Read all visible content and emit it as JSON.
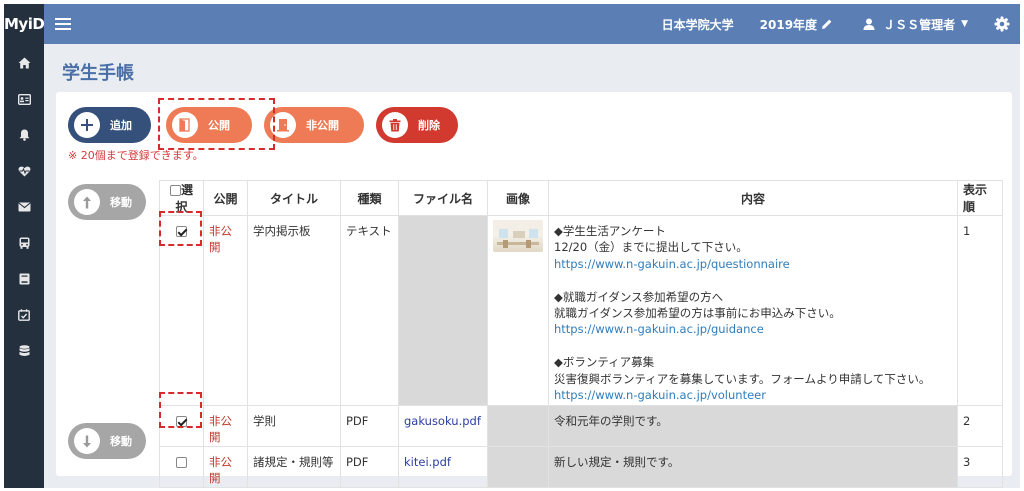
{
  "app": {
    "brand": "MyiD"
  },
  "header": {
    "university": "日本学院大学",
    "year": "2019年度",
    "user": "ＪＳＳ管理者"
  },
  "sidebar": {
    "icons": [
      "home-icon",
      "id-card-icon",
      "bell-icon",
      "heartbeat-icon",
      "envelope-icon",
      "bus-icon",
      "book-icon",
      "calendar-check-icon",
      "database-icon"
    ]
  },
  "page": {
    "title": "学生手帳"
  },
  "toolbar": {
    "add": "追加",
    "publish": "公開",
    "unpublish": "非公開",
    "delete": "削除",
    "note": "※ 20個まで登録できます。"
  },
  "move": {
    "up": "移動",
    "down": "移動"
  },
  "table": {
    "headers": {
      "select": "選択",
      "public": "公開",
      "title": "タイトル",
      "kind": "種類",
      "file": "ファイル名",
      "image": "画像",
      "content": "内容",
      "order": "表示順"
    },
    "rows": [
      {
        "checked": true,
        "public": "非公開",
        "title": "学内掲示板",
        "kind": "テキスト",
        "file": "",
        "content": [
          "◆学生生活アンケート",
          "12/20（金）までに提出して下さい。",
          "https://www.n-gakuin.ac.jp/questionnaire",
          "",
          "◆就職ガイダンス参加希望の方へ",
          "就職ガイダンス参加希望の方は事前にお申込み下さい。",
          "https://www.n-gakuin.ac.jp/guidance",
          "",
          "◆ボランティア募集",
          "災害復興ボランティアを募集しています。フォームより申請して下さい。",
          "https://www.n-gakuin.ac.jp/volunteer"
        ],
        "order": "1"
      },
      {
        "checked": true,
        "public": "非公開",
        "title": "学則",
        "kind": "PDF",
        "file": "gakusoku.pdf",
        "content": "令和元年の学則です。",
        "order": "2"
      },
      {
        "checked": false,
        "public": "非公開",
        "title": "諸規定・規則等",
        "kind": "PDF",
        "file": "kitei.pdf",
        "content": "新しい規定・規則です。",
        "order": "3"
      }
    ]
  }
}
